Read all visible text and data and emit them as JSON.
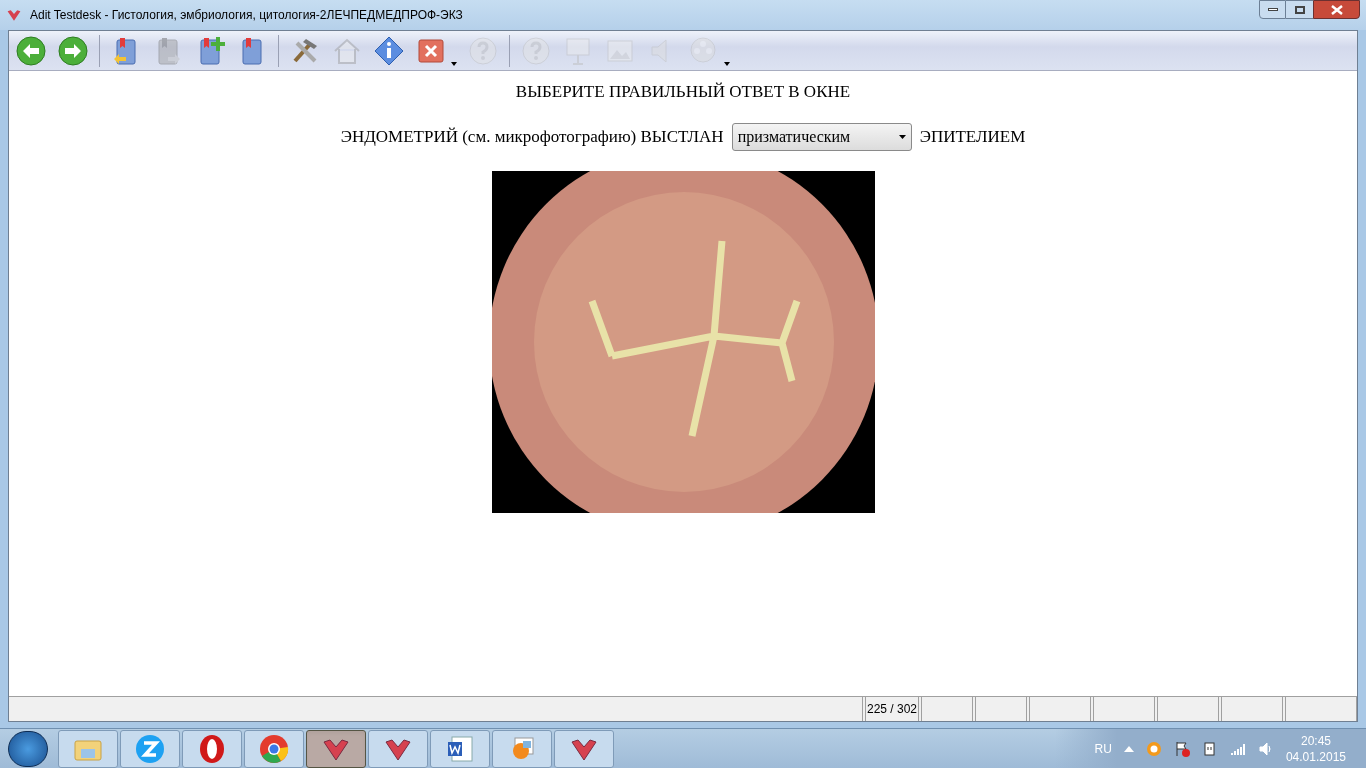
{
  "window": {
    "title": "Adit Testdesk - Гистология, эмбриология, цитология-2ЛЕЧПЕДМЕДПРОФ-ЭКЗ"
  },
  "toolbar": {
    "items": [
      {
        "kind": "back",
        "disabled": false
      },
      {
        "kind": "forward",
        "disabled": false
      },
      {
        "kind": "sep"
      },
      {
        "kind": "bookmark-back",
        "disabled": false
      },
      {
        "kind": "bookmark-next",
        "disabled": true
      },
      {
        "kind": "bookmark-add",
        "disabled": false
      },
      {
        "kind": "bookmark",
        "disabled": false
      },
      {
        "kind": "sep"
      },
      {
        "kind": "tools",
        "disabled": false
      },
      {
        "kind": "home",
        "disabled": true
      },
      {
        "kind": "info",
        "disabled": false
      },
      {
        "kind": "close",
        "disabled": false
      },
      {
        "kind": "caret"
      },
      {
        "kind": "help",
        "disabled": true
      },
      {
        "kind": "sep"
      },
      {
        "kind": "question",
        "disabled": true
      },
      {
        "kind": "board",
        "disabled": true
      },
      {
        "kind": "image",
        "disabled": true
      },
      {
        "kind": "sound",
        "disabled": true
      },
      {
        "kind": "film",
        "disabled": true
      },
      {
        "kind": "caret"
      }
    ]
  },
  "question": {
    "instruction": "ВЫБЕРИТЕ ПРАВИЛЬНЫЙ ОТВЕТ В ОКНЕ",
    "before": "ЭНДОМЕТРИЙ (см. микрофотографию) ВЫСТЛАН",
    "answer": "призматическим",
    "after": "ЭПИТЕЛИЕМ"
  },
  "status_bar": {
    "counter": "225 / 302"
  },
  "taskbar": {
    "items": [
      {
        "kind": "folder",
        "selected": false
      },
      {
        "kind": "z",
        "selected": false
      },
      {
        "kind": "opera",
        "selected": false
      },
      {
        "kind": "chrome",
        "selected": false
      },
      {
        "kind": "check",
        "selected": true
      },
      {
        "kind": "check",
        "selected": false
      },
      {
        "kind": "word",
        "selected": false
      },
      {
        "kind": "paint",
        "selected": false
      },
      {
        "kind": "check",
        "selected": false
      }
    ]
  },
  "tray": {
    "language": "RU",
    "time": "20:45",
    "date": "04.01.2015"
  }
}
